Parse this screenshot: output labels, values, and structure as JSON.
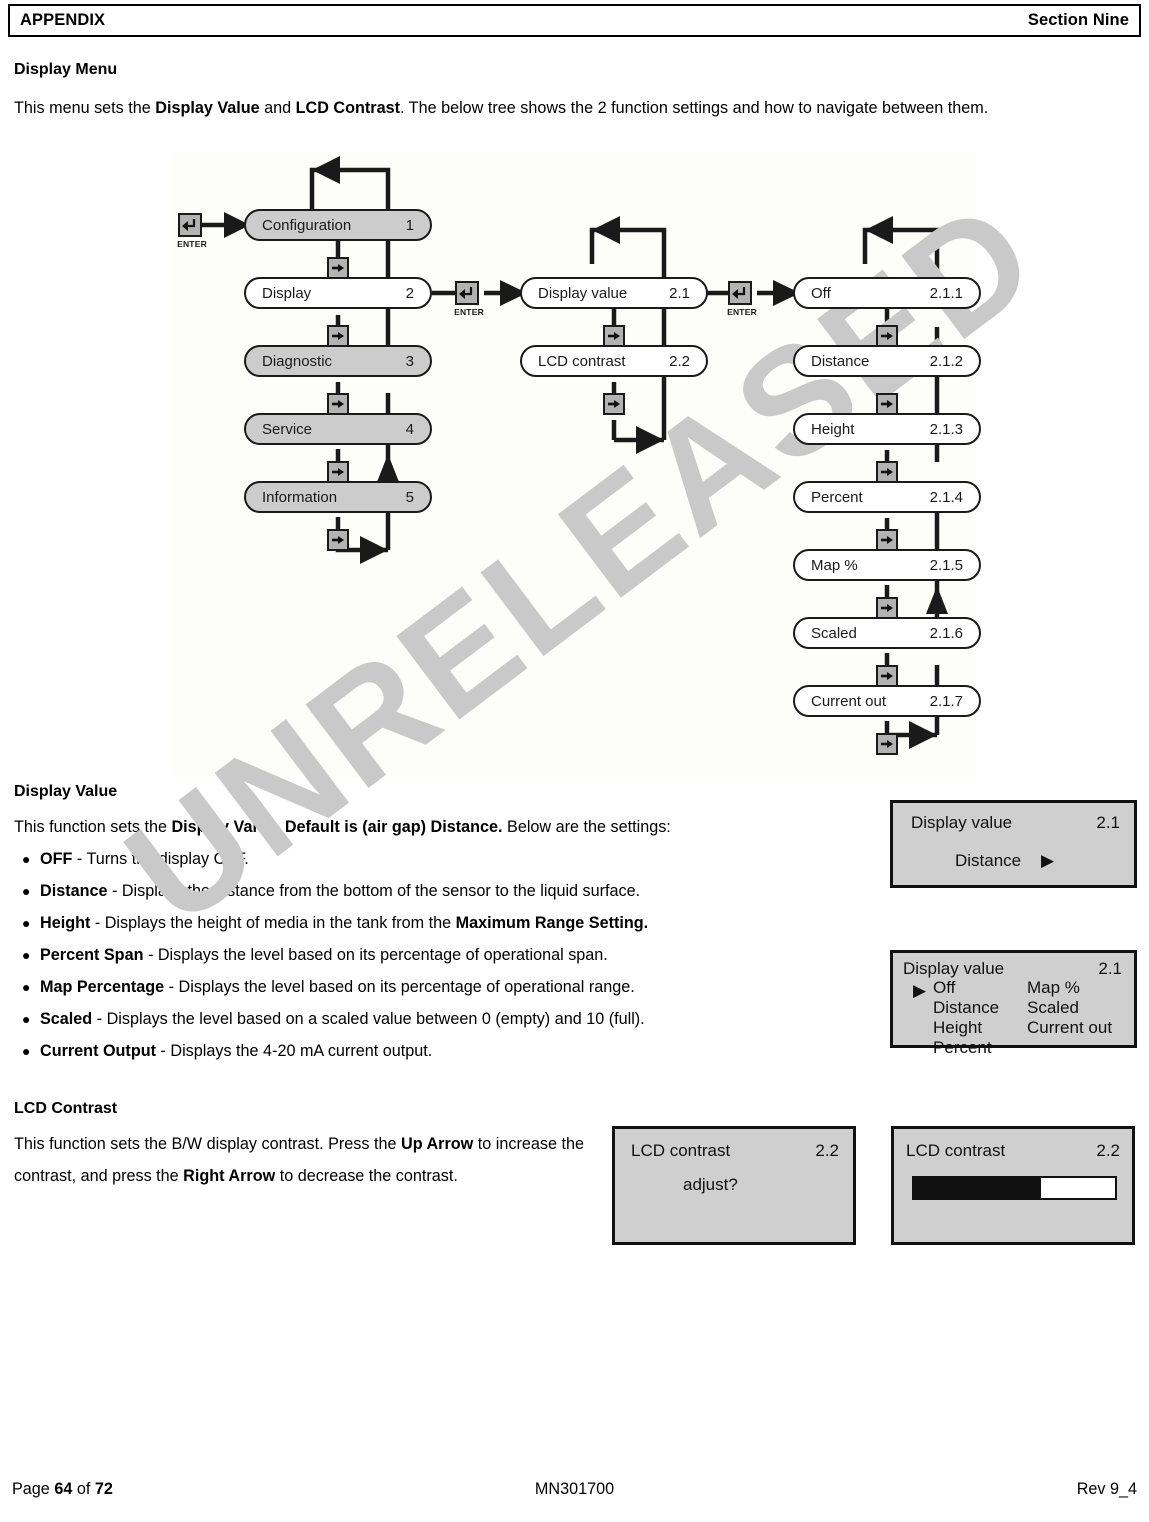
{
  "header": {
    "left": "APPENDIX",
    "right": "Section Nine"
  },
  "sections": {
    "display_menu": {
      "heading": "Display Menu",
      "paragraph_html": "This menu sets the <b>Display Value</b> and <b>LCD Contrast</b>.  The below tree shows the 2 function settings and how to navigate between them."
    },
    "display_value": {
      "heading": "Display Value",
      "paragraph_html": "This function sets the <b>Display Value</b>.  <b>Default is (air gap) Distance.</b>  Below are the settings:",
      "bullets": [
        {
          "term": "OFF",
          "desc": " - Turns the display OFF."
        },
        {
          "term": "Distance",
          "desc": " - Displays the distance from the bottom of the sensor to the liquid surface."
        },
        {
          "term": "Height",
          "desc": " - Displays the height of media in the tank from the <b>Maximum Range Setting.</b>"
        },
        {
          "term": "Percent Span",
          "desc": " - Displays the level based on its percentage of operational span."
        },
        {
          "term": "Map Percentage",
          "desc": " - Displays the level based on its percentage of operational range."
        },
        {
          "term": "Scaled",
          "desc": " - Displays the level based on a scaled value between 0 (empty) and 10 (full)."
        },
        {
          "term": "Current Output",
          "desc": " - Displays the 4-20 mA current output."
        }
      ]
    },
    "lcd_contrast": {
      "heading": "LCD Contrast",
      "paragraph_html": "This function sets the B/W display contrast.  Press the <b>Up Arrow</b> to increase the contrast, and press the <b>Right Arrow</b> to decrease the contrast."
    }
  },
  "diagram": {
    "enter_label": "ENTER",
    "column1": [
      {
        "label": "Configuration",
        "num": "1",
        "fill": "gray"
      },
      {
        "label": "Display",
        "num": "2",
        "fill": "white"
      },
      {
        "label": "Diagnostic",
        "num": "3",
        "fill": "gray"
      },
      {
        "label": "Service",
        "num": "4",
        "fill": "gray"
      },
      {
        "label": "Information",
        "num": "5",
        "fill": "gray"
      }
    ],
    "column2": [
      {
        "label": "Display value",
        "num": "2.1",
        "fill": "white"
      },
      {
        "label": "LCD contrast",
        "num": "2.2",
        "fill": "white"
      }
    ],
    "column3": [
      {
        "label": "Off",
        "num": "2.1.1",
        "fill": "white"
      },
      {
        "label": "Distance",
        "num": "2.1.2",
        "fill": "white"
      },
      {
        "label": "Height",
        "num": "2.1.3",
        "fill": "white"
      },
      {
        "label": "Percent",
        "num": "2.1.4",
        "fill": "white"
      },
      {
        "label": "Map %",
        "num": "2.1.5",
        "fill": "white"
      },
      {
        "label": "Scaled",
        "num": "2.1.6",
        "fill": "white"
      },
      {
        "label": "Current out",
        "num": "2.1.7",
        "fill": "white"
      }
    ]
  },
  "lcd_panels": {
    "display_value_single": {
      "title": "Display value",
      "num": "2.1",
      "selection": "Distance",
      "cursor": "▶"
    },
    "display_value_list": {
      "title": "Display value",
      "num": "2.1",
      "cursor": "▶",
      "col_left": [
        "Off",
        "Distance",
        "Height",
        "Percent"
      ],
      "col_right": [
        "Map %",
        "Scaled",
        "Current out"
      ],
      "selected": "Distance"
    },
    "lcd_contrast_adjust": {
      "title": "LCD contrast",
      "num": "2.2",
      "prompt": "adjust?"
    },
    "lcd_contrast_bar": {
      "title": "LCD contrast",
      "num": "2.2",
      "fill_percent": 63
    }
  },
  "watermark": {
    "text": "UNRELEASED"
  },
  "footer": {
    "page_prefix": "Page ",
    "page_number": "64",
    "page_of": " of ",
    "page_total": "72",
    "doc_number": "MN301700",
    "revision": "Rev 9_4"
  }
}
